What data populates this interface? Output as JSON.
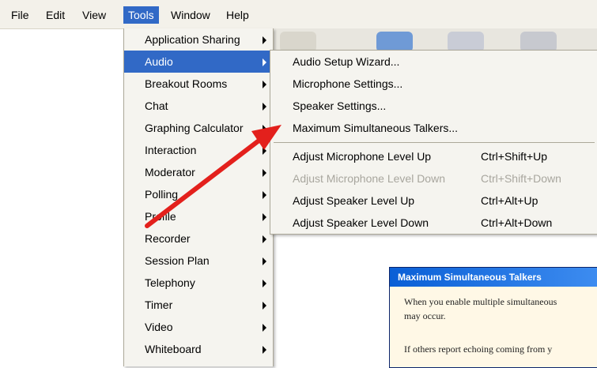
{
  "menubar": {
    "items": [
      {
        "label": "File",
        "active": false
      },
      {
        "label": "Edit",
        "active": false
      },
      {
        "label": "View",
        "active": false
      },
      {
        "label": "Tools",
        "active": true
      },
      {
        "label": "Window",
        "active": false
      },
      {
        "label": "Help",
        "active": false
      }
    ]
  },
  "tools_menu": {
    "items": [
      {
        "label": "Application Sharing",
        "active": false
      },
      {
        "label": "Audio",
        "active": true
      },
      {
        "label": "Breakout Rooms",
        "active": false
      },
      {
        "label": "Chat",
        "active": false
      },
      {
        "label": "Graphing Calculator",
        "active": false
      },
      {
        "label": "Interaction",
        "active": false
      },
      {
        "label": "Moderator",
        "active": false
      },
      {
        "label": "Polling",
        "active": false
      },
      {
        "label": "Profile",
        "active": false
      },
      {
        "label": "Recorder",
        "active": false
      },
      {
        "label": "Session Plan",
        "active": false
      },
      {
        "label": "Telephony",
        "active": false
      },
      {
        "label": "Timer",
        "active": false
      },
      {
        "label": "Video",
        "active": false
      },
      {
        "label": "Whiteboard",
        "active": false
      }
    ]
  },
  "audio_menu": {
    "group1": [
      {
        "label": "Audio Setup Wizard..."
      },
      {
        "label": "Microphone Settings..."
      },
      {
        "label": "Speaker Settings..."
      },
      {
        "label": "Maximum Simultaneous Talkers..."
      }
    ],
    "group2": [
      {
        "label": "Adjust Microphone Level Up",
        "shortcut": "Ctrl+Shift+Up",
        "enabled": true
      },
      {
        "label": "Adjust Microphone Level Down",
        "shortcut": "Ctrl+Shift+Down",
        "enabled": false
      },
      {
        "label": "Adjust Speaker Level Up",
        "shortcut": "Ctrl+Alt+Up",
        "enabled": true
      },
      {
        "label": "Adjust Speaker Level Down",
        "shortcut": "Ctrl+Alt+Down",
        "enabled": true
      }
    ]
  },
  "dialog": {
    "title": "Maximum Simultaneous Talkers",
    "line1": "When you enable multiple simultaneous",
    "line2": "may occur.",
    "line3": "If others report echoing coming from y"
  },
  "colors": {
    "highlight": "#3169c6",
    "arrow": "#e3201c"
  }
}
